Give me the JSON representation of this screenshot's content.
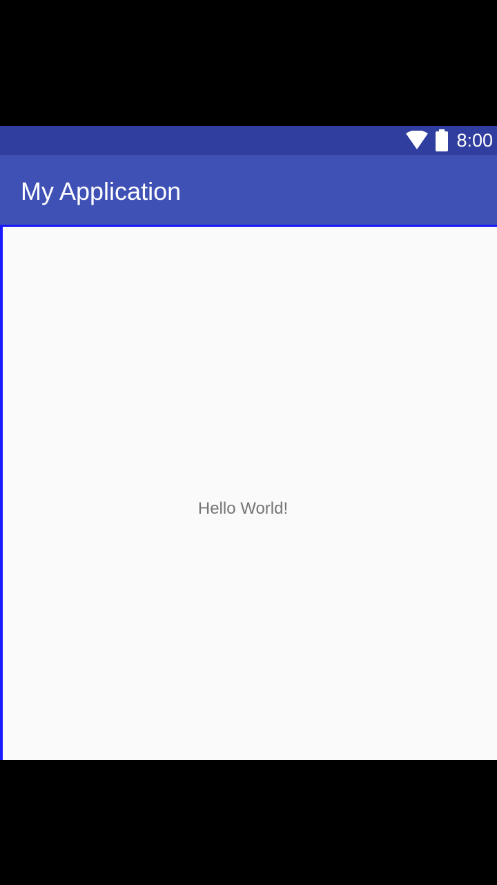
{
  "status_bar": {
    "time": "8:00",
    "icons": [
      "wifi-icon",
      "battery-icon"
    ],
    "color": "#303f9f"
  },
  "app_bar": {
    "title": "My Application",
    "color": "#3f51b5"
  },
  "main": {
    "text": "Hello World!",
    "background": "#fafafa"
  }
}
